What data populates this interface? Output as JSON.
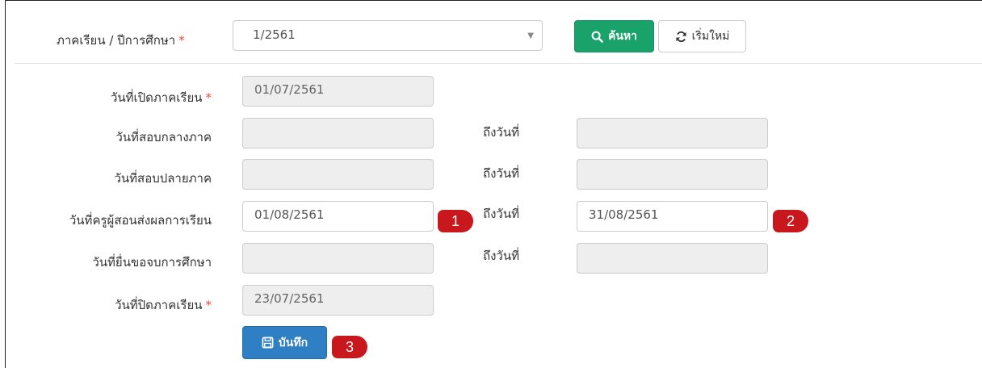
{
  "search": {
    "label": "ภาคเรียน / ปีการศึกษา",
    "required_mark": "*",
    "selected": "1/2561",
    "search_button": "ค้นหา",
    "reset_button": "เริ่มใหม่"
  },
  "form": {
    "rows": [
      {
        "label": "วันที่เปิดภาคเรียน",
        "required": "*",
        "from": "01/07/2561",
        "to_label": "",
        "to": ""
      },
      {
        "label": "วันที่สอบกลางภาค",
        "required": "",
        "from": "",
        "to_label": "ถึงวันที่",
        "to": ""
      },
      {
        "label": "วันที่สอบปลายภาค",
        "required": "",
        "from": "",
        "to_label": "ถึงวันที่",
        "to": ""
      },
      {
        "label": "วันที่ครูผู้สอนส่งผลการเรียน",
        "required": "",
        "from": "01/08/2561",
        "to_label": "ถึงวันที่",
        "to": "31/08/2561"
      },
      {
        "label": "วันที่ยื่นขอจบการศึกษา",
        "required": "",
        "from": "",
        "to_label": "ถึงวันที่",
        "to": ""
      },
      {
        "label": "วันที่ปิดภาคเรียน",
        "required": "*",
        "from": "23/07/2561",
        "to_label": "",
        "to": ""
      }
    ],
    "save_button": "บันทึก"
  },
  "markers": [
    "1",
    "2",
    "3"
  ],
  "colors": {
    "search_button": "#19a36b",
    "save_button": "#2f7fc4",
    "marker": "#c8171d",
    "required": "#e74c3c"
  },
  "icons": {
    "search": "search-icon",
    "reset": "refresh-icon",
    "save": "floppy-disk-icon",
    "dropdown": "caret-down-icon"
  }
}
